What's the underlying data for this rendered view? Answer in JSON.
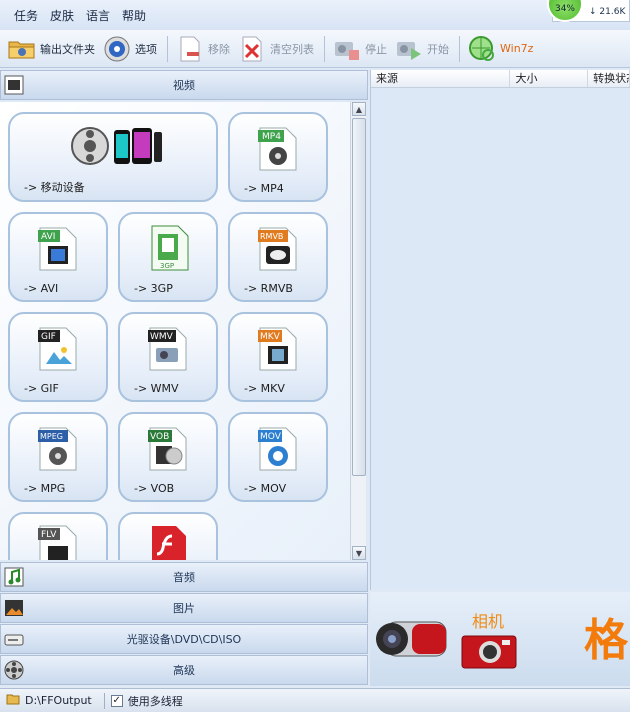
{
  "menu": [
    "任务",
    "皮肤",
    "语言",
    "帮助"
  ],
  "toolbar": {
    "output_folder": "输出文件夹",
    "options": "选项",
    "remove": "移除",
    "clear_list": "清空列表",
    "stop": "停止",
    "start": "开始",
    "win7z": "Win7z"
  },
  "net_widget": {
    "percent": "34%",
    "speed": "21.6K"
  },
  "categories": {
    "video": "视频",
    "audio": "音频",
    "image": "图片",
    "optical": "光驱设备\\DVD\\CD\\ISO",
    "advanced": "高级"
  },
  "formats": [
    {
      "label": "-> 移动设备",
      "icon": "mobile-device-icon"
    },
    {
      "label": "-> MP4",
      "tag": "MP4",
      "icon": "mp4-file-icon"
    },
    {
      "label": "-> AVI",
      "tag": "AVI",
      "icon": "avi-file-icon"
    },
    {
      "label": "-> 3GP",
      "tag": "3GP",
      "icon": "3gp-file-icon"
    },
    {
      "label": "-> RMVB",
      "tag": "RMVB",
      "icon": "rmvb-file-icon"
    },
    {
      "label": "-> GIF",
      "tag": "GIF",
      "icon": "gif-file-icon"
    },
    {
      "label": "-> WMV",
      "tag": "WMV",
      "icon": "wmv-file-icon"
    },
    {
      "label": "-> MKV",
      "tag": "MKV",
      "icon": "mkv-file-icon"
    },
    {
      "label": "-> MPG",
      "tag": "MPEG",
      "icon": "mpeg-file-icon"
    },
    {
      "label": "-> VOB",
      "tag": "VOB",
      "icon": "vob-file-icon"
    },
    {
      "label": "-> MOV",
      "tag": "MOV",
      "icon": "mov-file-icon"
    },
    {
      "label": "",
      "tag": "FLV",
      "icon": "flv-file-icon"
    },
    {
      "label": "",
      "icon": "swf-file-icon"
    }
  ],
  "task_table": {
    "columns": [
      "来源",
      "大小",
      "转换状态"
    ]
  },
  "banner": {
    "camera_label": "相机",
    "big_text": "格"
  },
  "statusbar": {
    "output_path": "D:\\FFOutput",
    "multithread_label": "使用多线程",
    "multithread_checked": "✓"
  },
  "colors": {
    "accent": "#f27b0c",
    "tile_border": "#a9c2de",
    "panel_bg": "#dfe9f5"
  }
}
